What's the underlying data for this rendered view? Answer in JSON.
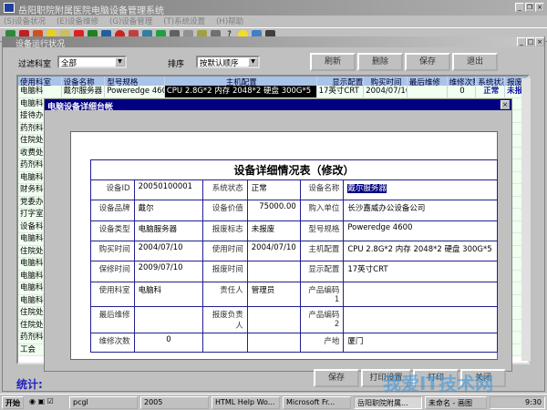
{
  "app": {
    "title": "岳阳职院附属医院电脑设备管理系统"
  },
  "menu": [
    "(S)设备状况",
    "(E)设备维修",
    "(G)设备管理",
    "(T)系统设置",
    "(H)帮助"
  ],
  "child": {
    "title": "设备运行状况"
  },
  "filter": {
    "label": "过滤科室",
    "value": "全部",
    "sort_label": "排序",
    "sort_value": "按默认顺序"
  },
  "buttons": {
    "refresh": "刷新",
    "delete": "删除",
    "save": "保存",
    "exit": "退出"
  },
  "grid": {
    "columns": [
      "使用科室",
      "设备名称",
      "型号规格",
      "主机配置",
      "显示配置",
      "购买时间",
      "最后维修",
      "维修次数",
      "系统状况",
      "报废标"
    ],
    "first_row": [
      "电脑科",
      "戴尔服务器",
      "Poweredge 4600",
      "CPU 2.8G*2 内存 2048*2 硬盘 300G*5",
      "17英寸CRT",
      "2004/07/10",
      "",
      "0",
      "正常",
      "未报废"
    ],
    "departments": [
      "电脑科",
      "接待办",
      "药剂科",
      "住院处",
      "收费处",
      "药剂科",
      "电脑科",
      "财务科",
      "党委办",
      "打字室",
      "设备科",
      "电脑科",
      "住院处",
      "电脑科",
      "电脑科",
      "电脑科",
      "电脑科",
      "住院处",
      "住院处",
      "药剂科",
      "工会"
    ]
  },
  "dialog": {
    "title": "电脑设备详细台帐",
    "heading": "设备详细情况表（修改）",
    "rows": [
      [
        "设备ID",
        "20050100001",
        "系统状态",
        "正常",
        "设备名称",
        "戴尔服务器"
      ],
      [
        "设备品牌",
        "戴尔",
        "设备价值",
        "75000.00",
        "购入单位",
        "长沙嘉威办公设备公司"
      ],
      [
        "设备类型",
        "电脑服务器",
        "报废标志",
        "未报废",
        "型号规格",
        "Poweredge 4600"
      ],
      [
        "购买时间",
        "2004/07/10",
        "使用时间",
        "2004/07/10",
        "主机配置",
        "CPU 2.8G*2 内存 2048*2 硬盘 300G*5"
      ],
      [
        "保修时间",
        "2009/07/10",
        "报废时间",
        "",
        "显示配置",
        "17英寸CRT"
      ],
      [
        "使用科室",
        "电脑科",
        "责任人",
        "管理员",
        "产品编码1",
        ""
      ],
      [
        "最后维修",
        "",
        "报废负责人",
        "",
        "产品编码2",
        ""
      ],
      [
        "维修次数",
        "0",
        "",
        "",
        "产地",
        "厦门"
      ]
    ],
    "buttons": {
      "save": "保存",
      "print_setup": "打印设置",
      "print": "打印",
      "close": "关闭"
    }
  },
  "stats": {
    "label": "统计:"
  },
  "taskbar": {
    "start": "开始",
    "tasks": [
      "pcgl",
      "2005",
      "HTML Help Wo...",
      "Microsoft Fr...",
      "岳阳职院附属...",
      "未命名 - 画图"
    ],
    "clock": "9:30"
  },
  "watermark": "我爱IT技术网"
}
